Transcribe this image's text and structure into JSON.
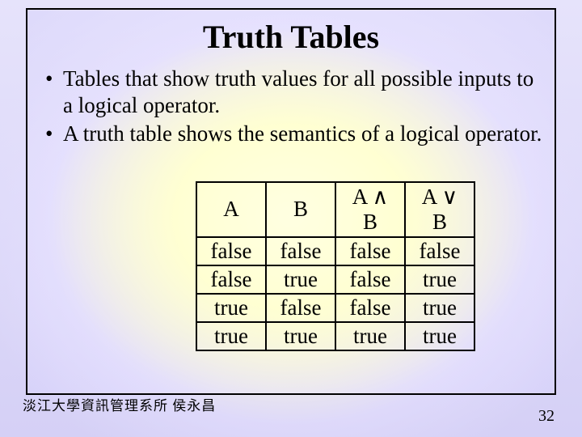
{
  "title": "Truth Tables",
  "bullets": [
    "Tables that show truth values for all possible inputs to a logical operator.",
    "A truth table shows the semantics of a logical operator."
  ],
  "table": {
    "headers": {
      "A": "A",
      "B": "B",
      "and_top": "A ∧",
      "and_bot": "B",
      "or_top": "A ∨",
      "or_bot": "B"
    },
    "rows": [
      {
        "A": "false",
        "B": "false",
        "and": "false",
        "or": "false"
      },
      {
        "A": "false",
        "B": "true",
        "and": "false",
        "or": "true"
      },
      {
        "A": "true",
        "B": "false",
        "and": "false",
        "or": "true"
      },
      {
        "A": "true",
        "B": "true",
        "and": "true",
        "or": "true"
      }
    ]
  },
  "footer_credit": "淡江大學資訊管理系所 侯永昌",
  "slide_number": "32"
}
